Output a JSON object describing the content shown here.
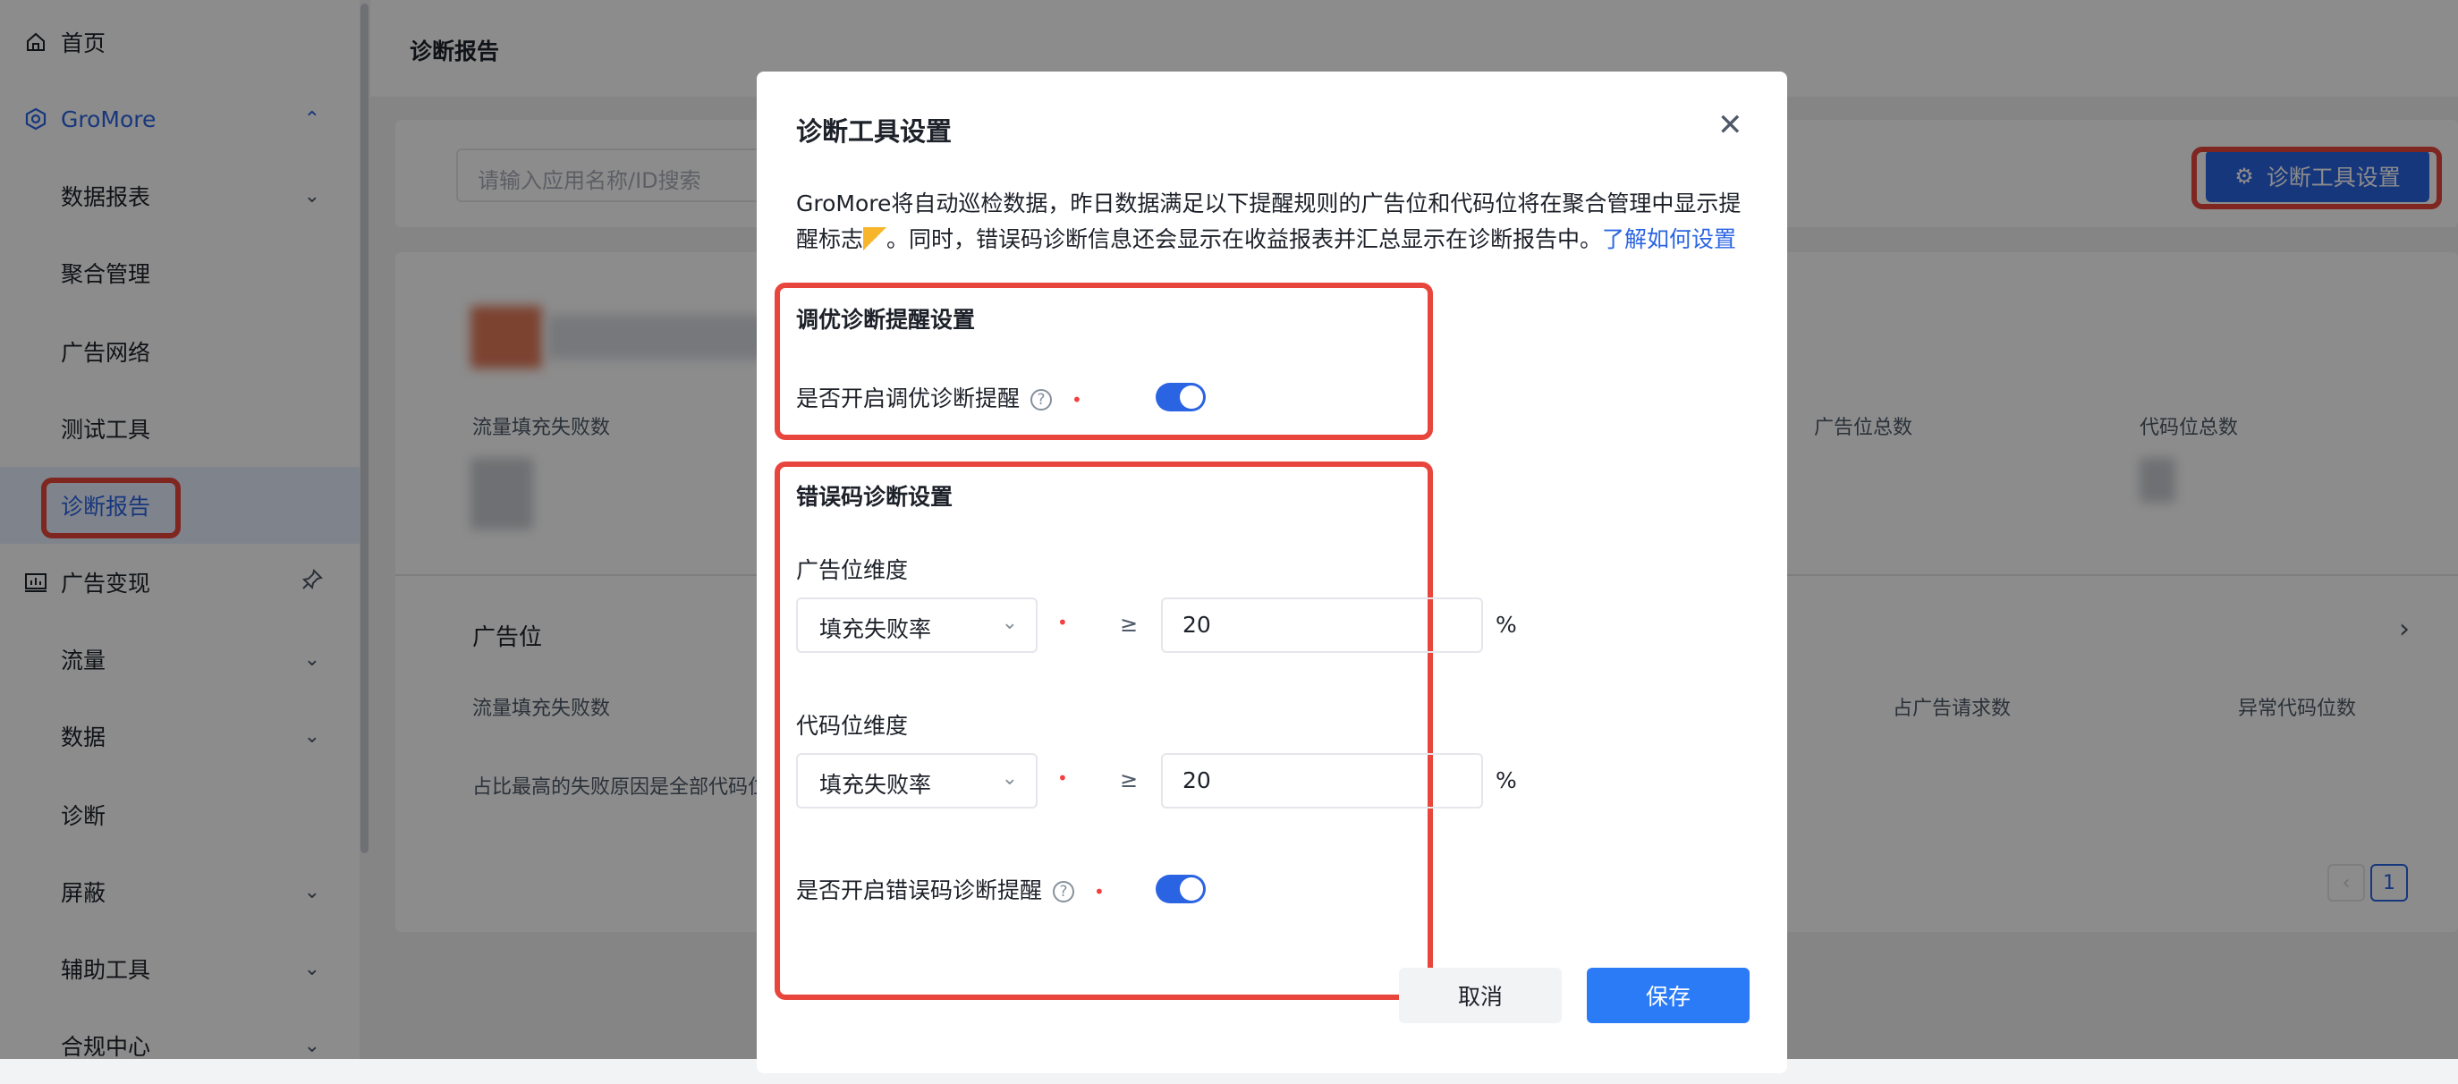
{
  "sidebar": {
    "items": [
      {
        "label": "首页"
      },
      {
        "label": "GroMore"
      },
      {
        "label": "数据报表"
      },
      {
        "label": "聚合管理"
      },
      {
        "label": "广告网络"
      },
      {
        "label": "测试工具"
      },
      {
        "label": "诊断报告"
      },
      {
        "label": "广告变现"
      },
      {
        "label": "流量"
      },
      {
        "label": "数据"
      },
      {
        "label": "诊断"
      },
      {
        "label": "屏蔽"
      },
      {
        "label": "辅助工具"
      },
      {
        "label": "合规中心"
      }
    ]
  },
  "header": {
    "breadcrumb": "诊断报告"
  },
  "toolbar": {
    "search_placeholder": "请输入应用名称/ID搜索",
    "tool_settings_label": "诊断工具设置"
  },
  "overview": {
    "fill_fail_label": "流量填充失败数",
    "ad_slot_total_label": "广告位总数",
    "code_slot_total_label": "代码位总数"
  },
  "ad_slot": {
    "title": "广告位",
    "fill_fail_label": "流量填充失败数",
    "note": "占比最高的失败原因是全部代码位",
    "ratio_label": "占广告请求数",
    "abnormal_label": "异常代码位数"
  },
  "pagination": {
    "current": "1"
  },
  "modal": {
    "title": "诊断工具设置",
    "desc_part1": "GroMore将自动巡检数据，昨日数据满足以下提醒规则的广告位和代码位将在聚合管理中显示提醒标志",
    "desc_part2": "。同时，错误码诊断信息还会显示在收益报表并汇总显示在诊断报告中。",
    "desc_link": "了解如何设置",
    "tuning_section": {
      "title": "调优诊断提醒设置",
      "toggle_label": "是否开启调优诊断提醒",
      "enabled": true
    },
    "error_section": {
      "title": "错误码诊断设置",
      "ad_dimension_label": "广告位维度",
      "ad_metric": "填充失败率",
      "ad_operator": "≥",
      "ad_threshold": "20",
      "ad_unit": "%",
      "code_dimension_label": "代码位维度",
      "code_metric": "填充失败率",
      "code_operator": "≥",
      "code_threshold": "20",
      "code_unit": "%",
      "toggle_label": "是否开启错误码诊断提醒",
      "enabled": true
    },
    "cancel_label": "取消",
    "save_label": "保存"
  },
  "colors": {
    "accent": "#2b64e3",
    "highlight": "#e8453c",
    "required": "#f53f3f"
  }
}
